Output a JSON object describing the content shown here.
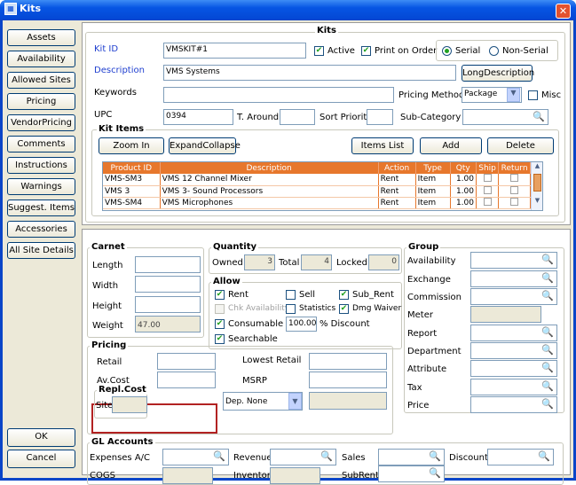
{
  "window": {
    "title": "Kits"
  },
  "nav": [
    "Assets",
    "Availability",
    "Allowed Sites",
    "Pricing",
    "VendorPricing",
    "Comments",
    "Instructions",
    "Warnings",
    "Suggest. Items",
    "Accessories",
    "All Site Details"
  ],
  "bottom_buttons": {
    "ok": "OK",
    "cancel": "Cancel"
  },
  "kits": {
    "group_title": "Kits",
    "kit_id_label": "Kit ID",
    "kit_id": "VMSKIT#1",
    "active_label": "Active",
    "print_on_order_label": "Print on Order",
    "serial_label": "Serial",
    "non_serial_label": "Non-Serial",
    "description_label": "Description",
    "description": "VMS Systems",
    "long_description_button": "LongDescription",
    "keywords_label": "Keywords",
    "keywords": "",
    "pricing_method_label": "Pricing Method",
    "pricing_method": "Package",
    "misc_label": "Misc",
    "upc_label": "UPC",
    "upc": "0394",
    "turn_around_label": "T. Around",
    "sort_priority_label": "Sort Priority",
    "sub_category_label": "Sub-Category"
  },
  "kit_items": {
    "title": "Kit Items",
    "zoom_in": "Zoom In",
    "expand_collapse": "ExpandCollapse",
    "items_list": "Items List",
    "add": "Add",
    "delete": "Delete",
    "columns": [
      "Product ID",
      "Description",
      "Action",
      "Type",
      "Qty",
      "Ship",
      "Return"
    ],
    "rows": [
      [
        "VMS-SM3",
        "VMS 12  Channel Mixer",
        "Rent",
        "Item",
        "1.00"
      ],
      [
        "VMS 3",
        "VMS 3- Sound Processors",
        "Rent",
        "Item",
        "1.00"
      ],
      [
        "VMS-SM4",
        "VMS Microphones",
        "Rent",
        "Item",
        "1.00"
      ]
    ]
  },
  "carnet": {
    "title": "Carnet",
    "length": "Length",
    "width": "Width",
    "height": "Height",
    "weight": "Weight",
    "weight_value": "47.00"
  },
  "quantity": {
    "title": "Quantity",
    "owned": "Owned",
    "owned_value": "3",
    "total": "Total",
    "total_value": "4",
    "locked": "Locked",
    "locked_value": "0"
  },
  "allow": {
    "title": "Allow",
    "rent": "Rent",
    "sell": "Sell",
    "sub_rent": "Sub_Rent",
    "chk_availability": "Chk Availability",
    "statistics": "Statistics",
    "dmg_waiver": "Dmg Waiver",
    "consumable": "Consumable",
    "discount_value": "100.00",
    "discount_label": "% Discount",
    "searchable": "Searchable"
  },
  "pricing": {
    "title": "Pricing",
    "retail": "Retail",
    "av_cost": "Av.Cost",
    "lowest_retail": "Lowest Retail",
    "msrp": "MSRP",
    "repl_cost": "Repl.Cost",
    "site": "Site",
    "dep": "Dep. None"
  },
  "group": {
    "title": "Group",
    "availability": "Availability",
    "exchange": "Exchange",
    "commission": "Commission",
    "meter": "Meter",
    "report": "Report",
    "department": "Department",
    "attribute": "Attribute",
    "tax": "Tax",
    "price": "Price"
  },
  "gl": {
    "title": "GL Accounts",
    "expenses": "Expenses A/C",
    "revenue": "Revenue",
    "sales": "Sales",
    "discount": "Discount",
    "cogs": "COGS",
    "inventory": "Inventory",
    "subrent": "SubRent"
  },
  "colors": {
    "titlebar": "#0655e3",
    "grid_header": "#e7772c",
    "highlight": "#b22222"
  }
}
